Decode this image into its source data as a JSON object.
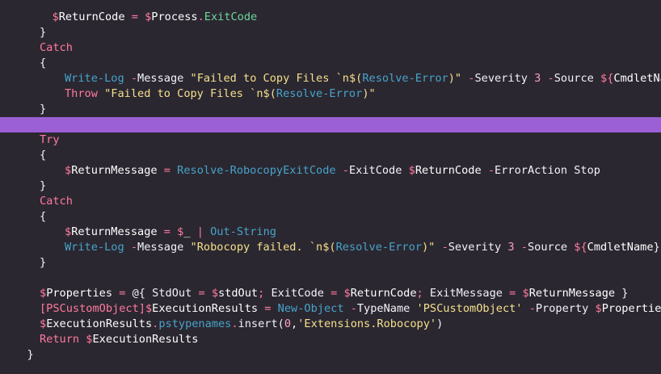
{
  "editor": {
    "colors": {
      "background": "#2b2731",
      "highlight": "#9b5fd6"
    },
    "lines": [
      {
        "indent": 6,
        "highlight": false,
        "tokens": [
          [
            "sig",
            "$"
          ],
          [
            "var",
            "ReturnCode"
          ],
          [
            "txt",
            " "
          ],
          [
            "op",
            "="
          ],
          [
            "txt",
            " "
          ],
          [
            "sig",
            "$"
          ],
          [
            "var",
            "Process"
          ],
          [
            "op",
            "."
          ],
          [
            "prop",
            "ExitCode"
          ]
        ]
      },
      {
        "indent": 4,
        "highlight": false,
        "tokens": [
          [
            "txt",
            "}"
          ]
        ]
      },
      {
        "indent": 4,
        "highlight": false,
        "tokens": [
          [
            "kw",
            "Catch"
          ]
        ]
      },
      {
        "indent": 4,
        "highlight": false,
        "tokens": [
          [
            "txt",
            "{"
          ]
        ]
      },
      {
        "indent": 8,
        "highlight": false,
        "tokens": [
          [
            "cmd",
            "Write-Log"
          ],
          [
            "txt",
            " "
          ],
          [
            "param",
            "-"
          ],
          [
            "txt",
            "Message "
          ],
          [
            "str",
            "\"Failed to Copy Files `n$("
          ],
          [
            "cmd",
            "Resolve-Error"
          ],
          [
            "str",
            ")\""
          ],
          [
            "txt",
            " "
          ],
          [
            "param",
            "-"
          ],
          [
            "txt",
            "Severity "
          ],
          [
            "num",
            "3"
          ],
          [
            "txt",
            " "
          ],
          [
            "param",
            "-"
          ],
          [
            "txt",
            "Source "
          ],
          [
            "sig",
            "${"
          ],
          [
            "var",
            "CmdletName"
          ],
          [
            "txt",
            "}"
          ]
        ]
      },
      {
        "indent": 8,
        "highlight": false,
        "tokens": [
          [
            "kw",
            "Throw"
          ],
          [
            "txt",
            " "
          ],
          [
            "str",
            "\"Failed to Copy Files `n$("
          ],
          [
            "cmd",
            "Resolve-Error"
          ],
          [
            "str",
            ")\""
          ]
        ]
      },
      {
        "indent": 4,
        "highlight": false,
        "tokens": [
          [
            "txt",
            "}"
          ]
        ]
      },
      {
        "indent": 0,
        "highlight": true,
        "tokens": []
      },
      {
        "indent": 4,
        "highlight": false,
        "tokens": [
          [
            "kw",
            "Try"
          ]
        ]
      },
      {
        "indent": 4,
        "highlight": false,
        "tokens": [
          [
            "txt",
            "{"
          ]
        ]
      },
      {
        "indent": 8,
        "highlight": false,
        "tokens": [
          [
            "sig",
            "$"
          ],
          [
            "var",
            "ReturnMessage"
          ],
          [
            "txt",
            " "
          ],
          [
            "op",
            "="
          ],
          [
            "txt",
            " "
          ],
          [
            "cmd",
            "Resolve-RobocopyExitCode"
          ],
          [
            "txt",
            " "
          ],
          [
            "param",
            "-"
          ],
          [
            "txt",
            "ExitCode "
          ],
          [
            "sig",
            "$"
          ],
          [
            "var",
            "ReturnCode"
          ],
          [
            "txt",
            " "
          ],
          [
            "param",
            "-"
          ],
          [
            "txt",
            "ErrorAction Stop"
          ]
        ]
      },
      {
        "indent": 4,
        "highlight": false,
        "tokens": [
          [
            "txt",
            "}"
          ]
        ]
      },
      {
        "indent": 4,
        "highlight": false,
        "tokens": [
          [
            "kw",
            "Catch"
          ]
        ]
      },
      {
        "indent": 4,
        "highlight": false,
        "tokens": [
          [
            "txt",
            "{"
          ]
        ]
      },
      {
        "indent": 8,
        "highlight": false,
        "tokens": [
          [
            "sig",
            "$"
          ],
          [
            "var",
            "ReturnMessage"
          ],
          [
            "txt",
            " "
          ],
          [
            "op",
            "="
          ],
          [
            "txt",
            " "
          ],
          [
            "sig",
            "$"
          ],
          [
            "var",
            "_"
          ],
          [
            "txt",
            " "
          ],
          [
            "op",
            "|"
          ],
          [
            "txt",
            " "
          ],
          [
            "cmd",
            "Out-String"
          ]
        ]
      },
      {
        "indent": 8,
        "highlight": false,
        "tokens": [
          [
            "cmd",
            "Write-Log"
          ],
          [
            "txt",
            " "
          ],
          [
            "param",
            "-"
          ],
          [
            "txt",
            "Message "
          ],
          [
            "str",
            "\"Robocopy failed. `n$("
          ],
          [
            "cmd",
            "Resolve-Error"
          ],
          [
            "str",
            ")\""
          ],
          [
            "txt",
            " "
          ],
          [
            "param",
            "-"
          ],
          [
            "txt",
            "Severity "
          ],
          [
            "num",
            "3"
          ],
          [
            "txt",
            " "
          ],
          [
            "param",
            "-"
          ],
          [
            "txt",
            "Source "
          ],
          [
            "sig",
            "${"
          ],
          [
            "var",
            "CmdletName"
          ],
          [
            "txt",
            "}"
          ]
        ]
      },
      {
        "indent": 4,
        "highlight": false,
        "tokens": [
          [
            "txt",
            "}"
          ]
        ]
      },
      {
        "indent": 0,
        "highlight": false,
        "tokens": []
      },
      {
        "indent": 4,
        "highlight": false,
        "tokens": [
          [
            "sig",
            "$"
          ],
          [
            "var",
            "Properties"
          ],
          [
            "txt",
            " "
          ],
          [
            "op",
            "="
          ],
          [
            "txt",
            " @{ StdOut "
          ],
          [
            "op",
            "="
          ],
          [
            "txt",
            " "
          ],
          [
            "sig",
            "$"
          ],
          [
            "var",
            "stdOut"
          ],
          [
            "op",
            ";"
          ],
          [
            "txt",
            " ExitCode "
          ],
          [
            "op",
            "="
          ],
          [
            "txt",
            " "
          ],
          [
            "sig",
            "$"
          ],
          [
            "var",
            "ReturnCode"
          ],
          [
            "op",
            ";"
          ],
          [
            "txt",
            " ExitMessage "
          ],
          [
            "op",
            "="
          ],
          [
            "txt",
            " "
          ],
          [
            "sig",
            "$"
          ],
          [
            "var",
            "ReturnMessage"
          ],
          [
            "txt",
            " }"
          ]
        ]
      },
      {
        "indent": 4,
        "highlight": false,
        "tokens": [
          [
            "type",
            "[PSCustomObject]"
          ],
          [
            "sig",
            "$"
          ],
          [
            "var",
            "ExecutionResults"
          ],
          [
            "txt",
            " "
          ],
          [
            "op",
            "="
          ],
          [
            "txt",
            " "
          ],
          [
            "cmd",
            "New-Object"
          ],
          [
            "txt",
            " "
          ],
          [
            "param",
            "-"
          ],
          [
            "txt",
            "TypeName "
          ],
          [
            "str",
            "'PSCustomObject'"
          ],
          [
            "txt",
            " "
          ],
          [
            "param",
            "-"
          ],
          [
            "txt",
            "Property "
          ],
          [
            "sig",
            "$"
          ],
          [
            "var",
            "Properties"
          ]
        ]
      },
      {
        "indent": 4,
        "highlight": false,
        "tokens": [
          [
            "sig",
            "$"
          ],
          [
            "var",
            "ExecutionResults"
          ],
          [
            "op",
            "."
          ],
          [
            "cmd",
            "pstypenames"
          ],
          [
            "op",
            "."
          ],
          [
            "txt",
            "insert("
          ],
          [
            "num",
            "0"
          ],
          [
            "txt",
            ","
          ],
          [
            "str",
            "'Extensions.Robocopy'"
          ],
          [
            "txt",
            ")"
          ]
        ]
      },
      {
        "indent": 4,
        "highlight": false,
        "tokens": [
          [
            "kw",
            "Return"
          ],
          [
            "txt",
            " "
          ],
          [
            "sig",
            "$"
          ],
          [
            "var",
            "ExecutionResults"
          ]
        ]
      },
      {
        "indent": 2,
        "highlight": false,
        "tokens": [
          [
            "txt",
            "}"
          ]
        ]
      }
    ]
  }
}
